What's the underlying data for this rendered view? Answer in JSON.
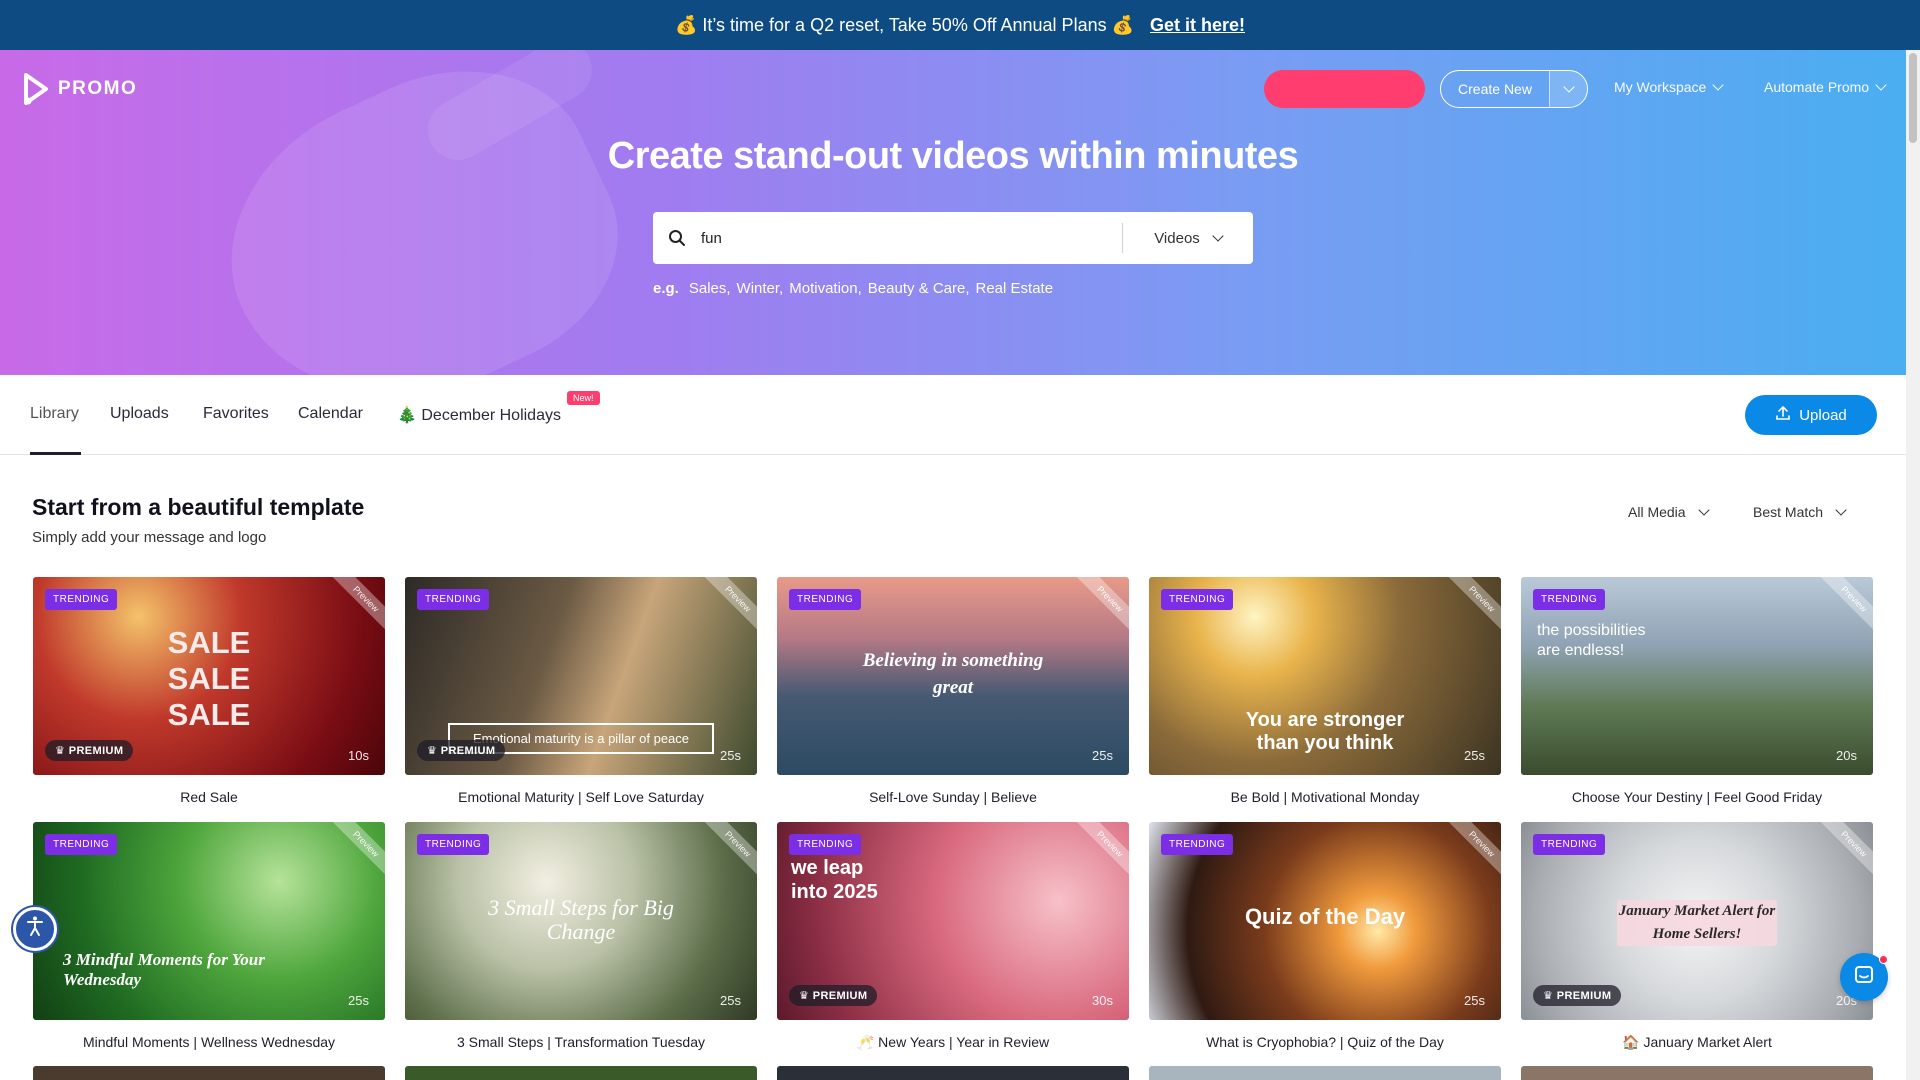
{
  "promo": {
    "message": "💰 It’s time for a Q2 reset, Take 50% Off Annual Plans 💰",
    "cta": "Get it here!"
  },
  "brand": {
    "name": "PROMO"
  },
  "nav": {
    "create_new": "Create New",
    "workspace": "My Workspace",
    "automate": "Automate Promo"
  },
  "hero": {
    "title": "Create stand-out videos within minutes",
    "search_value": "fun",
    "media_type": "Videos",
    "eg_label": "e.g.",
    "examples": [
      "Sales,",
      "Winter,",
      "Motivation,",
      "Beauty & Care,",
      "Real Estate"
    ]
  },
  "tabs": {
    "library": "Library",
    "uploads": "Uploads",
    "favorites": "Favorites",
    "calendar": "Calendar",
    "holidays": "🎄 December Holidays",
    "new_badge": "New!",
    "upload_button": "Upload"
  },
  "section": {
    "title": "Start from a beautiful template",
    "subtitle": "Simply add your message and logo",
    "filter_media": "All Media",
    "filter_sort": "Best Match"
  },
  "labels": {
    "trending": "TRENDING",
    "premium": "♛ PREMIUM",
    "preview": "Preview"
  },
  "cards": [
    {
      "title": "Red Sale",
      "duration": "10s",
      "overlay": "SALE\nSALE\nSALE"
    },
    {
      "title": "Emotional Maturity | Self Love Saturday",
      "duration": "25s",
      "overlay": "Emotional maturity is a pillar of peace"
    },
    {
      "title": "Self-Love Sunday | Believe",
      "duration": "25s",
      "overlay": "Believing in something great"
    },
    {
      "title": "Be Bold | Motivational Monday",
      "duration": "25s",
      "overlay": "You are stronger than you think"
    },
    {
      "title": "Choose Your Destiny | Feel Good Friday",
      "duration": "20s",
      "overlay": "the possibilities are endless!"
    },
    {
      "title": "Mindful Moments | Wellness Wednesday",
      "duration": "25s",
      "overlay": "3 Mindful Moments for Your Wednesday"
    },
    {
      "title": "3 Small Steps | Transformation Tuesday",
      "duration": "25s",
      "overlay": "3 Small Steps for Big Change"
    },
    {
      "title": "🥂 New Years | Year in Review",
      "duration": "30s",
      "overlay": "we leap into 2025"
    },
    {
      "title": "What is Cryophobia? | Quiz of the Day",
      "duration": "25s",
      "overlay": "Quiz of the Day"
    },
    {
      "title": "🏠 January Market Alert",
      "duration": "20s",
      "overlay": "January Market Alert for Home Sellers!"
    }
  ],
  "colors": {
    "promo_bar": "#0d4b82",
    "accent_pink": "#ff3d6e",
    "accent_blue": "#0b89e6",
    "trending_purple": "#7c2ee6"
  }
}
